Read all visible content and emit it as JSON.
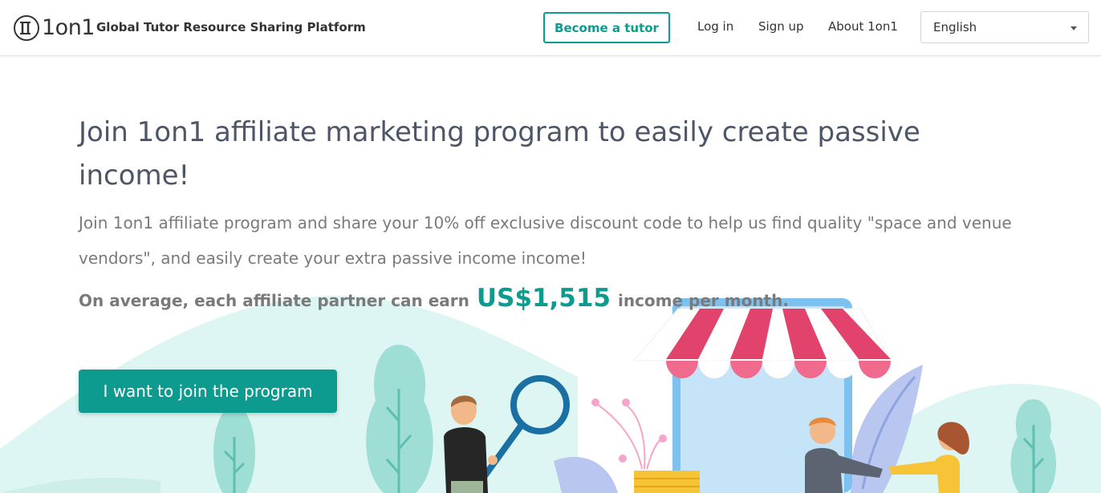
{
  "header": {
    "logo_text": "1on1",
    "tagline": "Global Tutor Resource Sharing Platform",
    "become_tutor": "Become a tutor",
    "login": "Log in",
    "signup": "Sign up",
    "about": "About 1on1",
    "language": "English"
  },
  "hero": {
    "title": "Join 1on1 affiliate marketing program to easily create passive income!",
    "subtitle": "Join 1on1 affiliate program and share your 10% off exclusive discount code to help us find quality \"space and venue vendors\", and easily create your extra passive income income!",
    "earn_prefix": "On average, each affiliate partner can earn",
    "earn_amount": "US$1,515",
    "earn_suffix": "income per month.",
    "cta": "I want to join the program"
  },
  "colors": {
    "brand": "#0e9b8f",
    "title": "#4d5666",
    "muted": "#7a7a7a",
    "awning_red": "#e1436d",
    "mint": "#def6f3"
  }
}
